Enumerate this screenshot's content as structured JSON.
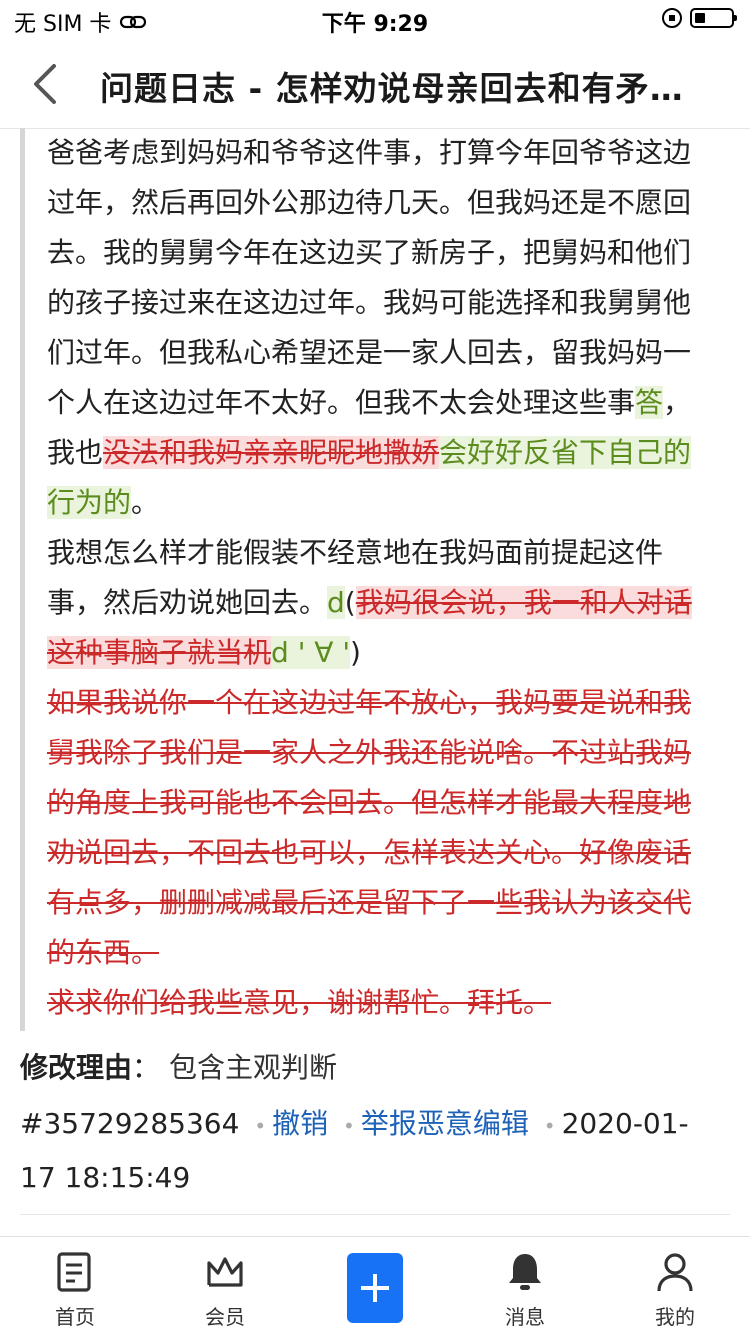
{
  "status_bar": {
    "carrier": "无 SIM 卡",
    "time": "下午 9:29"
  },
  "nav": {
    "title": "问题日志 - 怎样劝说母亲回去和有矛盾的家人一起过年？"
  },
  "diff": {
    "segments": [
      {
        "type": "text",
        "text": "爸爸考虑到妈妈和爷爷这件事，打算今年回爷爷这边过年，然后再回外公那边待几天。但我妈还是不愿回去。我的舅舅今年在这边买了新房子，把舅妈和他们的孩子接过来在这边过年。我妈可能选择和我舅舅他们过年。但我私心希望还是一家人回去，留我妈妈一个人在这边过年不太好。但我不太会处理这些事"
      },
      {
        "type": "ins",
        "text": "答"
      },
      {
        "type": "text",
        "text": "，我也"
      },
      {
        "type": "del",
        "text": "没法和我妈亲亲昵昵地撒娇"
      },
      {
        "type": "ins",
        "text": "会好好反省下自己的行为的"
      },
      {
        "type": "text",
        "text": "。"
      },
      {
        "type": "br"
      },
      {
        "type": "text",
        "text": "我想怎么样才能假装不经意地在我妈面前提起这件事，然后劝说她回去。"
      },
      {
        "type": "ins",
        "text": "d"
      },
      {
        "type": "text",
        "text": "("
      },
      {
        "type": "del",
        "text": "我妈很会说，我一和人对话这种事脑子就当机"
      },
      {
        "type": "ins",
        "text": "d ' ∀ '"
      },
      {
        "type": "text",
        "text": ")"
      },
      {
        "type": "br"
      },
      {
        "type": "deltext",
        "text": "如果我说你一个在这边过年不放心，我妈要是说和我舅我除了我们是一家人之外我还能说啥。不过站我妈的角度上我可能也不会回去。但怎样才能最大程度地劝说回去，不回去也可以，怎样表达关心。好像废话有点多，删删减减最后还是留下了一些我认为该交代的东西。"
      },
      {
        "type": "br"
      },
      {
        "type": "deltext",
        "text": "求求你们给我些意见，谢谢帮忙。拜托。"
      }
    ]
  },
  "reason": {
    "label": "修改理由",
    "sep": "：",
    "value": "包含主观判断"
  },
  "meta": {
    "id": "#35729285364",
    "revert": "撤销",
    "report": "举报恶意编辑",
    "timestamp": "2020-01-17 18:15:49"
  },
  "tabs": [
    {
      "label": "首页",
      "icon": "document-icon"
    },
    {
      "label": "会员",
      "icon": "crown-icon"
    },
    {
      "label": "",
      "icon": "add-icon"
    },
    {
      "label": "消息",
      "icon": "bell-icon"
    },
    {
      "label": "我的",
      "icon": "person-icon"
    }
  ],
  "colors": {
    "insert_text": "#5d8c1e",
    "insert_bg": "#eaf4dc",
    "delete_text": "#cc2a2a",
    "delete_bg": "#fbdcdc",
    "link": "#1e62b8",
    "accent": "#1772f6"
  }
}
